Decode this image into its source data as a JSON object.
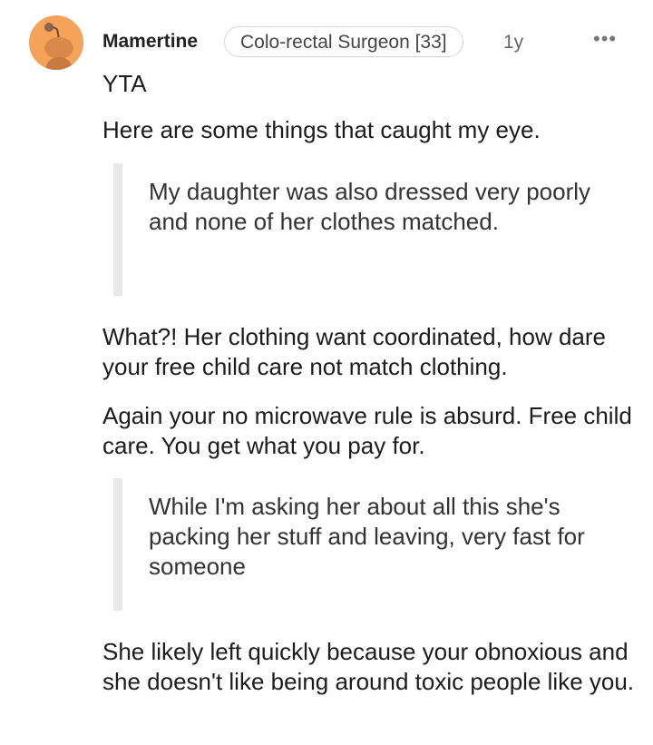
{
  "comment": {
    "author": "Mamertine",
    "flair": "Colo-rectal Surgeon [33]",
    "age": "1y",
    "more_label": "•••",
    "paragraphs": [
      "YTA",
      "Here are some things that caught my eye.",
      "What?! Her clothing want coordinated, how dare your free child care not match clothing.",
      "Again your no microwave rule is absurd. Free child care. You get what you pay for.",
      "She likely left quickly because your obnoxious and she doesn't like being around toxic people like you."
    ],
    "quotes": [
      "My daughter was also dressed very poorly and none of her clothes matched.",
      "While I'm asking her about all this she's packing her stuff and leaving, very fast for someone"
    ]
  },
  "colors": {
    "avatar_bg": "#f5a35b",
    "quote_bar": "#e8e8e8"
  }
}
